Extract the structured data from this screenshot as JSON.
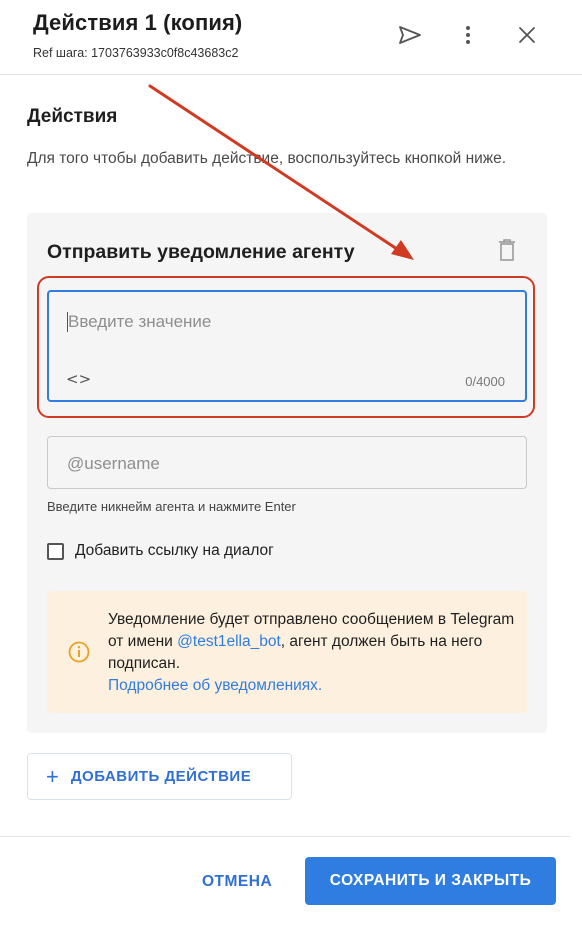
{
  "header": {
    "title": "Действия 1 (копия)",
    "ref": "Ref шага: 1703763933c0f8c43683c2",
    "icons": [
      "send-icon",
      "more-vertical-icon",
      "close-icon"
    ]
  },
  "section": {
    "title": "Действия",
    "description": "Для того чтобы добавить действие, воспользуйтесь кнопкой ниже."
  },
  "action_card": {
    "title": "Отправить уведомление агенту",
    "message_field": {
      "value": "",
      "placeholder": "Введите значение",
      "counter": "0/4000",
      "code_icon": "<>"
    },
    "username_field": {
      "value": "",
      "placeholder": "@username",
      "helper": "Введите никнейм агента и нажмите Enter"
    },
    "checkbox": {
      "label": "Добавить ссылку на диалог",
      "checked": false
    },
    "info": {
      "text_before": "Уведомление будет отправлено сообщением в Telegram от имени ",
      "bot_link": "@test1ella_bot",
      "text_after": ", агент должен быть на него подписан.",
      "more_link": "Подробнее об уведомлениях.",
      "icon": "info-icon"
    }
  },
  "add_button": {
    "plus": "+",
    "label": "ДОБАВИТЬ ДЕЙСТВИЕ"
  },
  "footer": {
    "cancel_label": "ОТМЕНА",
    "save_label": "СОХРАНИТЬ И ЗАКРЫТЬ"
  },
  "colors": {
    "accent": "#2f7de1",
    "annotation": "#d03a22",
    "info_background": "#fdf0de",
    "card_background": "#f5f5f6"
  }
}
